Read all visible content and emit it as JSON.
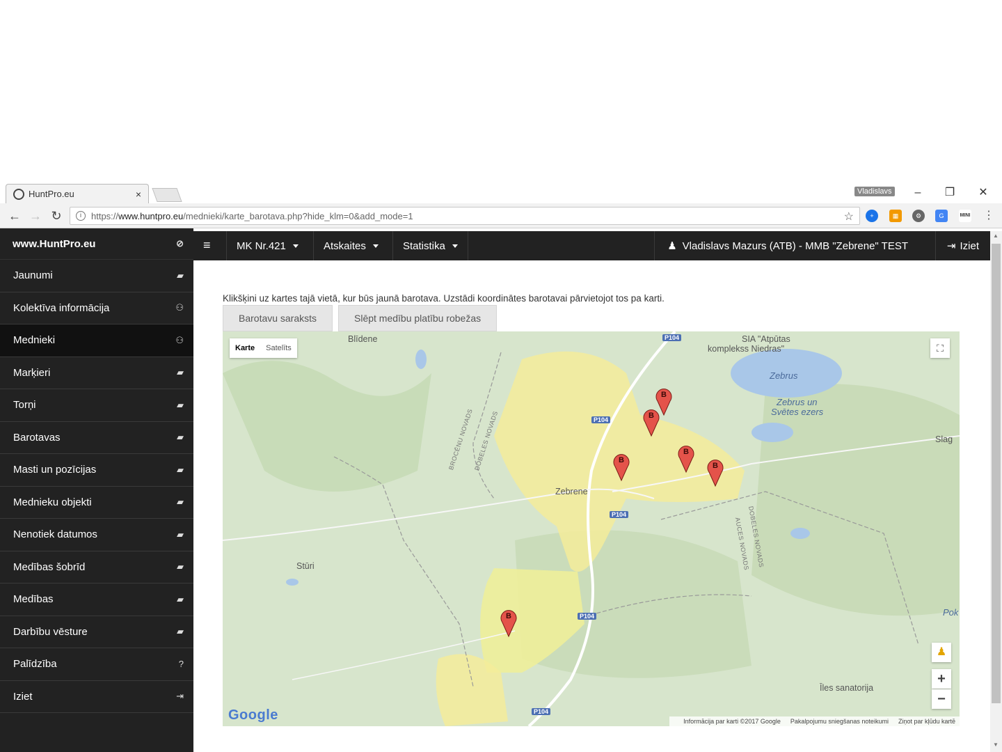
{
  "browser": {
    "tab_title": "HuntPro.eu",
    "tab_close": "×",
    "profile_name": "Vladislavs",
    "url_prefix": "https://",
    "url_host": "www.huntpro.eu",
    "url_path": "/mednieki/karte_barotava.php?hide_klm=0&add_mode=1",
    "minimize": "–",
    "restore": "❐",
    "close": "✕"
  },
  "sidebar": {
    "brand": "www.HuntPro.eu",
    "items": [
      {
        "label": "Jaunumi",
        "icon": "book-icon"
      },
      {
        "label": "Kolektīva informācija",
        "icon": "users-icon"
      },
      {
        "label": "Mednieki",
        "icon": "users-icon"
      },
      {
        "label": "Marķieri",
        "icon": "book-icon"
      },
      {
        "label": "Torņi",
        "icon": "book-icon"
      },
      {
        "label": "Barotavas",
        "icon": "book-icon"
      },
      {
        "label": "Masti un pozīcijas",
        "icon": "book-icon"
      },
      {
        "label": "Mednieku objekti",
        "icon": "book-icon"
      },
      {
        "label": "Nenotiek datumos",
        "icon": "book-icon"
      },
      {
        "label": "Medības šobrīd",
        "icon": "book-icon"
      },
      {
        "label": "Medības",
        "icon": "book-icon"
      },
      {
        "label": "Darbību vēsture",
        "icon": "book-icon"
      },
      {
        "label": "Palīdzība",
        "icon": "question-icon"
      },
      {
        "label": "Iziet",
        "icon": "sign-out-icon"
      }
    ]
  },
  "topnav": {
    "menu1": "MK Nr.421",
    "menu2": "Atskaites",
    "menu3": "Statistika",
    "user": "Vladislavs Mazurs (ATB) - MMB \"Zebrene\" TEST",
    "exit": "Iziet"
  },
  "content": {
    "instruction": "Klikšķini uz kartes tajā vietā, kur būs jaunā barotava. Uzstādi koordinātes barotavai pārvietojot tos pa karti.",
    "btn_list": "Barotavu saraksts",
    "btn_hide": "Slēpt medību platību robežas"
  },
  "map": {
    "type_map": "Karte",
    "type_sat": "Satelīts",
    "marker_letter": "B",
    "labels": {
      "blidene": "Blīdene",
      "sia": "SIA \"Atpūtas",
      "sia2": "komplekss Niedras\"",
      "zebrus": "Zebrus",
      "zebrus2": "Zebrus un",
      "zebrus3": "Svētes ezers",
      "slag": "Slag",
      "zebrene": "Zebrene",
      "sturi": "Stūri",
      "pok": "Pok",
      "iles": "Īles sanatorija",
      "road": "P104",
      "brocenu": "BROCĒNU NOVADS",
      "dobeles1": "DOBELES NOVADS",
      "dobeles2": "DOBELES NOVADS",
      "auces": "AUCES NOVADS"
    },
    "google": "Google",
    "attr1": "Informācija par karti ©2017 Google",
    "attr2": "Pakalpojumu sniegšanas noteikumi",
    "attr3": "Ziņot par kļūdu kartē",
    "zoom_in": "+",
    "zoom_out": "−"
  }
}
